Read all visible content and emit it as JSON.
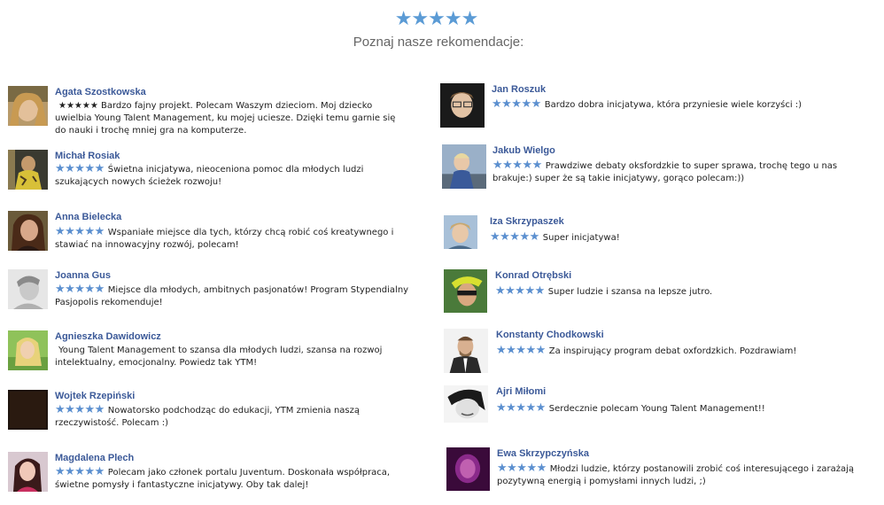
{
  "rating_stars": "★★★★★",
  "headline": "Poznaj nasze rekomendacje:",
  "reviews": [
    {
      "name": "Agata Szostkowska",
      "stars": "",
      "text": "★★★★★ Bardzo fajny projekt. Polecam Waszym dzieciom. Moj dziecko uwielbia Young Talent Management, ku mojej uciesze. Dzięki temu garnie się do nauki i trochę mniej gra na komputerze."
    },
    {
      "name": "Michał Rosiak",
      "stars": "★★★★★",
      "text": "Świetna inicjatywa, nieoceniona pomoc dla młodych ludzi szukających nowych ścieżek rozwoju!"
    },
    {
      "name": "Anna Bielecka",
      "stars": "★★★★★",
      "text": "Wspaniałe miejsce dla tych, którzy chcą robić coś kreatywnego i stawiać na innowacyjny rozwój, polecam!"
    },
    {
      "name": "Joanna Gus",
      "stars": "★★★★★",
      "text": "Miejsce dla młodych, ambitnych pasjonatów! Program Stypendialny Pasjopolis rekomenduje!"
    },
    {
      "name": "Agnieszka Dawidowicz",
      "stars": "",
      "text": "Young Talent Management to szansa dla młodych ludzi, szansa na rozwoj intelektualny, emocjonalny. Powiedz tak YTM!"
    },
    {
      "name": "Wojtek Rzepiński",
      "stars": "★★★★★",
      "text": "Nowatorsko podchodząc do edukacji, YTM zmienia naszą rzeczywistość. Polecam :)"
    },
    {
      "name": "Magdalena Plech",
      "stars": "★★★★★",
      "text": "Polecam jako członek portalu Juventum. Doskonała współpraca, świetne pomysły i fantastyczne inicjatywy. Oby tak dalej!"
    },
    {
      "name": "Jan Roszuk",
      "stars": "★★★★★",
      "text": "Bardzo dobra inicjatywa, która przyniesie wiele korzyści :)"
    },
    {
      "name": "Jakub Wielgo",
      "stars": "★★★★★",
      "text": "Prawdziwe debaty oksfordzkie to super sprawa, trochę tego u nas brakuje:) super że są takie inicjatywy, gorąco polecam:))"
    },
    {
      "name": "Iza Skrzypaszek",
      "stars": "★★★★★",
      "text": "Super inicjatywa!"
    },
    {
      "name": "Konrad Otrębski",
      "stars": "★★★★★",
      "text": "Super ludzie i szansa na lepsze jutro."
    },
    {
      "name": "Konstanty Chodkowski",
      "stars": "★★★★★",
      "text": "Za inspirujący program debat oxfordzkich. Pozdrawiam!"
    },
    {
      "name": "Ajri Miłomi",
      "stars": "★★★★★",
      "text": "Serdecznie polecam Young Talent Management!!"
    },
    {
      "name": "Ewa Skrzypczyńska",
      "stars": "★★★★★",
      "text": "Młodzi ludzie, którzy postanowili zrobić coś interesującego i zarażają pozytywną energią i pomysłami innych ludzi, ;)"
    }
  ],
  "colors": {
    "name_link": "#3b5998",
    "star_blue": "#5b8fcf",
    "headline_gray": "#666666"
  }
}
